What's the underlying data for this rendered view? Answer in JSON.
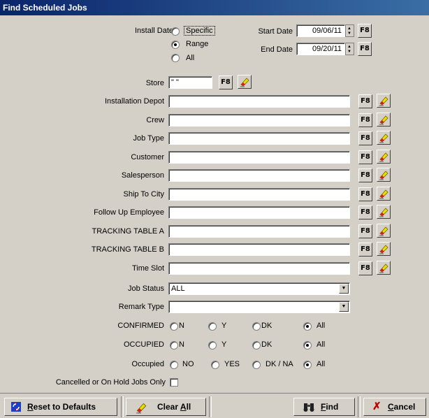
{
  "window": {
    "title": "Find Scheduled Jobs"
  },
  "install_date": {
    "label": "Install Date",
    "options": [
      {
        "label": "Specific",
        "selected": false
      },
      {
        "label": "Range",
        "selected": true
      },
      {
        "label": "All",
        "selected": false
      }
    ],
    "start_label": "Start Date",
    "start_value": "09/06/11",
    "end_label": "End Date",
    "end_value": "09/20/11",
    "f8": "F8"
  },
  "store": {
    "label": "Store",
    "value": "\" \"",
    "f8": "F8"
  },
  "fields": [
    {
      "label": "Installation Depot",
      "value": "",
      "f8": "F8"
    },
    {
      "label": "Crew",
      "value": "",
      "f8": "F8"
    },
    {
      "label": "Job Type",
      "value": "",
      "f8": "F8"
    },
    {
      "label": "Customer",
      "value": "",
      "f8": "F8"
    },
    {
      "label": "Salesperson",
      "value": "",
      "f8": "F8"
    },
    {
      "label": "Ship To City",
      "value": "",
      "f8": "F8"
    },
    {
      "label": "Follow Up Employee",
      "value": "",
      "f8": "F8"
    },
    {
      "label": "TRACKING TABLE A",
      "value": "",
      "f8": "F8"
    },
    {
      "label": "TRACKING TABLE B",
      "value": "",
      "f8": "F8"
    },
    {
      "label": "Time Slot",
      "value": "",
      "f8": "F8"
    }
  ],
  "job_status": {
    "label": "Job Status",
    "value": "ALL"
  },
  "remark_type": {
    "label": "Remark Type",
    "value": ""
  },
  "confirmed": {
    "label": "CONFIRMED",
    "options": [
      "N",
      "Y",
      "DK",
      "All"
    ],
    "selected": "All"
  },
  "occupied_caps": {
    "label": "OCCUPIED",
    "options": [
      "N",
      "Y",
      "DK",
      "All"
    ],
    "selected": "All"
  },
  "occupied": {
    "label": "Occupied",
    "options": [
      "NO",
      "YES",
      "DK / NA",
      "All"
    ],
    "selected": "All"
  },
  "cancelled": {
    "label": "Cancelled or On Hold Jobs Only",
    "checked": false
  },
  "buttons": {
    "reset_first": "R",
    "reset_rest": "eset to Defaults",
    "clear_first": "Clear ",
    "clear_u": "A",
    "clear_rest": "ll",
    "find_u": "F",
    "find_rest": "ind",
    "cancel_u": "C",
    "cancel_rest": "ancel"
  }
}
